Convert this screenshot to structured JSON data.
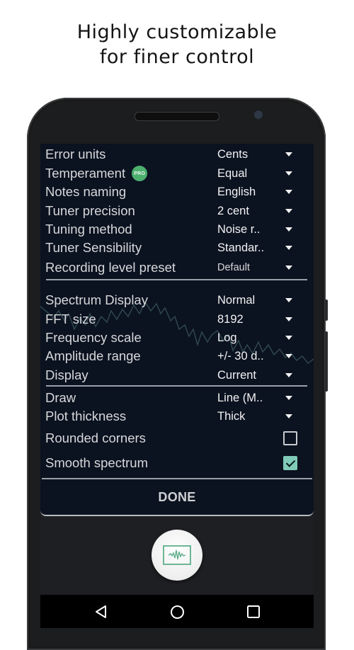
{
  "headline": {
    "line1": "Highly customizable",
    "line2": "for finer control"
  },
  "settings": {
    "group1": [
      {
        "label": "Error units",
        "value": "Cents",
        "type": "dropdown"
      },
      {
        "label": "Temperament",
        "badge": "PRO",
        "value": "Equal",
        "type": "dropdown"
      },
      {
        "label": "Notes naming",
        "value": "English",
        "type": "dropdown"
      },
      {
        "label": "Tuner precision",
        "value": "2 cent",
        "type": "dropdown"
      },
      {
        "label": "Tuning method",
        "value": "Noise r..",
        "type": "dropdown"
      },
      {
        "label": "Tuner Sensibility",
        "value": "Standar..",
        "type": "dropdown"
      },
      {
        "label": "Recording level preset",
        "value": "Default",
        "type": "dropdown"
      }
    ],
    "group2": [
      {
        "label": "Spectrum Display",
        "value": "Normal",
        "type": "dropdown"
      },
      {
        "label": "FFT size",
        "value": "8192",
        "type": "dropdown"
      },
      {
        "label": "Frequency scale",
        "value": "Log",
        "type": "dropdown"
      },
      {
        "label": "Amplitude range",
        "value": "+/- 30 d..",
        "type": "dropdown"
      },
      {
        "label": "Display",
        "value": "Current",
        "type": "dropdown"
      }
    ],
    "group3": [
      {
        "label": "Draw",
        "value": "Line (M..",
        "type": "dropdown"
      },
      {
        "label": "Plot thickness",
        "value": "Thick",
        "type": "dropdown"
      },
      {
        "label": "Rounded corners",
        "checked": false,
        "type": "checkbox"
      },
      {
        "label": "Smooth spectrum",
        "checked": true,
        "type": "checkbox"
      }
    ],
    "done_label": "DONE"
  },
  "fab": {
    "icon": "waveform-monitor-icon"
  },
  "navbar": {
    "back_icon": "back-triangle-icon",
    "home_icon": "home-circle-icon",
    "recents_icon": "recents-square-icon"
  },
  "colors": {
    "accent_green": "#4caf6e",
    "checkbox_teal": "#7fcbb8",
    "dialog_bg": "#0b1220",
    "icon_green": "#5fae8c"
  }
}
